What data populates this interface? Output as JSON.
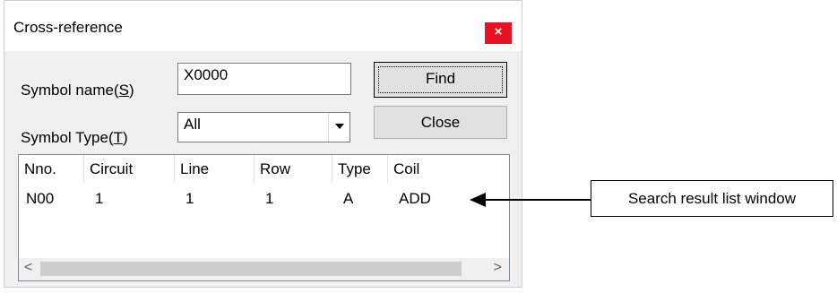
{
  "dialog": {
    "title": "Cross-reference",
    "close_glyph": "×",
    "symbol_name_label": "Symbol name(S)",
    "symbol_name_value": "X0000",
    "symbol_type_label": "Symbol Type(T)",
    "symbol_type_value": "All",
    "find_label": "Find",
    "close_label": "Close",
    "columns": [
      "Nno.",
      "Circuit",
      "Line",
      "Row",
      "Type",
      "Coil"
    ],
    "rows": [
      [
        "N00",
        "1",
        "1",
        "1",
        "A",
        "ADD"
      ]
    ],
    "scroll_left": "<",
    "scroll_right": ">"
  },
  "callout": {
    "text": "Search result list window"
  }
}
